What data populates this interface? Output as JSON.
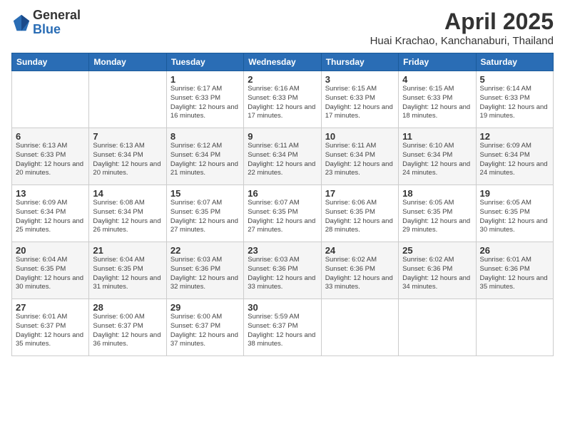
{
  "logo": {
    "general": "General",
    "blue": "Blue"
  },
  "header": {
    "month": "April 2025",
    "location": "Huai Krachao, Kanchanaburi, Thailand"
  },
  "weekdays": [
    "Sunday",
    "Monday",
    "Tuesday",
    "Wednesday",
    "Thursday",
    "Friday",
    "Saturday"
  ],
  "weeks": [
    [
      {
        "day": "",
        "info": ""
      },
      {
        "day": "",
        "info": ""
      },
      {
        "day": "1",
        "info": "Sunrise: 6:17 AM\nSunset: 6:33 PM\nDaylight: 12 hours\nand 16 minutes."
      },
      {
        "day": "2",
        "info": "Sunrise: 6:16 AM\nSunset: 6:33 PM\nDaylight: 12 hours\nand 17 minutes."
      },
      {
        "day": "3",
        "info": "Sunrise: 6:15 AM\nSunset: 6:33 PM\nDaylight: 12 hours\nand 17 minutes."
      },
      {
        "day": "4",
        "info": "Sunrise: 6:15 AM\nSunset: 6:33 PM\nDaylight: 12 hours\nand 18 minutes."
      },
      {
        "day": "5",
        "info": "Sunrise: 6:14 AM\nSunset: 6:33 PM\nDaylight: 12 hours\nand 19 minutes."
      }
    ],
    [
      {
        "day": "6",
        "info": "Sunrise: 6:13 AM\nSunset: 6:33 PM\nDaylight: 12 hours\nand 20 minutes."
      },
      {
        "day": "7",
        "info": "Sunrise: 6:13 AM\nSunset: 6:34 PM\nDaylight: 12 hours\nand 20 minutes."
      },
      {
        "day": "8",
        "info": "Sunrise: 6:12 AM\nSunset: 6:34 PM\nDaylight: 12 hours\nand 21 minutes."
      },
      {
        "day": "9",
        "info": "Sunrise: 6:11 AM\nSunset: 6:34 PM\nDaylight: 12 hours\nand 22 minutes."
      },
      {
        "day": "10",
        "info": "Sunrise: 6:11 AM\nSunset: 6:34 PM\nDaylight: 12 hours\nand 23 minutes."
      },
      {
        "day": "11",
        "info": "Sunrise: 6:10 AM\nSunset: 6:34 PM\nDaylight: 12 hours\nand 24 minutes."
      },
      {
        "day": "12",
        "info": "Sunrise: 6:09 AM\nSunset: 6:34 PM\nDaylight: 12 hours\nand 24 minutes."
      }
    ],
    [
      {
        "day": "13",
        "info": "Sunrise: 6:09 AM\nSunset: 6:34 PM\nDaylight: 12 hours\nand 25 minutes."
      },
      {
        "day": "14",
        "info": "Sunrise: 6:08 AM\nSunset: 6:34 PM\nDaylight: 12 hours\nand 26 minutes."
      },
      {
        "day": "15",
        "info": "Sunrise: 6:07 AM\nSunset: 6:35 PM\nDaylight: 12 hours\nand 27 minutes."
      },
      {
        "day": "16",
        "info": "Sunrise: 6:07 AM\nSunset: 6:35 PM\nDaylight: 12 hours\nand 27 minutes."
      },
      {
        "day": "17",
        "info": "Sunrise: 6:06 AM\nSunset: 6:35 PM\nDaylight: 12 hours\nand 28 minutes."
      },
      {
        "day": "18",
        "info": "Sunrise: 6:05 AM\nSunset: 6:35 PM\nDaylight: 12 hours\nand 29 minutes."
      },
      {
        "day": "19",
        "info": "Sunrise: 6:05 AM\nSunset: 6:35 PM\nDaylight: 12 hours\nand 30 minutes."
      }
    ],
    [
      {
        "day": "20",
        "info": "Sunrise: 6:04 AM\nSunset: 6:35 PM\nDaylight: 12 hours\nand 30 minutes."
      },
      {
        "day": "21",
        "info": "Sunrise: 6:04 AM\nSunset: 6:35 PM\nDaylight: 12 hours\nand 31 minutes."
      },
      {
        "day": "22",
        "info": "Sunrise: 6:03 AM\nSunset: 6:36 PM\nDaylight: 12 hours\nand 32 minutes."
      },
      {
        "day": "23",
        "info": "Sunrise: 6:03 AM\nSunset: 6:36 PM\nDaylight: 12 hours\nand 33 minutes."
      },
      {
        "day": "24",
        "info": "Sunrise: 6:02 AM\nSunset: 6:36 PM\nDaylight: 12 hours\nand 33 minutes."
      },
      {
        "day": "25",
        "info": "Sunrise: 6:02 AM\nSunset: 6:36 PM\nDaylight: 12 hours\nand 34 minutes."
      },
      {
        "day": "26",
        "info": "Sunrise: 6:01 AM\nSunset: 6:36 PM\nDaylight: 12 hours\nand 35 minutes."
      }
    ],
    [
      {
        "day": "27",
        "info": "Sunrise: 6:01 AM\nSunset: 6:37 PM\nDaylight: 12 hours\nand 35 minutes."
      },
      {
        "day": "28",
        "info": "Sunrise: 6:00 AM\nSunset: 6:37 PM\nDaylight: 12 hours\nand 36 minutes."
      },
      {
        "day": "29",
        "info": "Sunrise: 6:00 AM\nSunset: 6:37 PM\nDaylight: 12 hours\nand 37 minutes."
      },
      {
        "day": "30",
        "info": "Sunrise: 5:59 AM\nSunset: 6:37 PM\nDaylight: 12 hours\nand 38 minutes."
      },
      {
        "day": "",
        "info": ""
      },
      {
        "day": "",
        "info": ""
      },
      {
        "day": "",
        "info": ""
      }
    ]
  ]
}
